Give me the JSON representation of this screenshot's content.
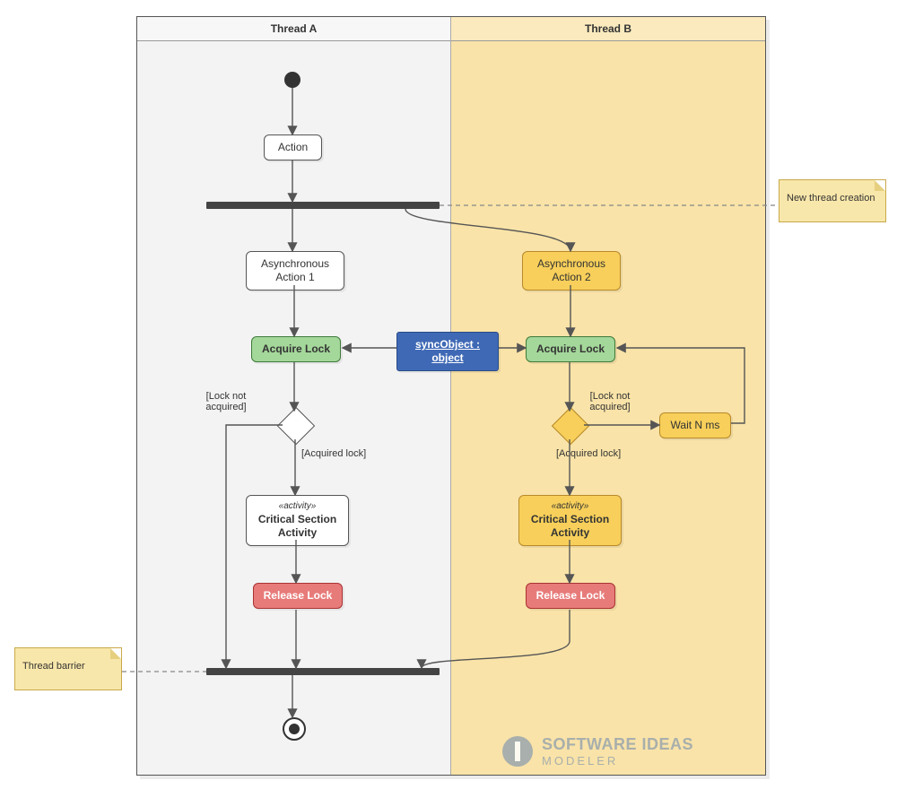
{
  "lanes": {
    "a": "Thread A",
    "b": "Thread B"
  },
  "nodes": {
    "action": "Action",
    "async1": "Asynchronous Action 1",
    "async2": "Asynchronous Action 2",
    "acquireA": "Acquire Lock",
    "acquireB": "Acquire Lock",
    "syncObj": "syncObject : object",
    "waitN": "Wait N ms",
    "critA_stereo": "«activity»",
    "critA_main": "Critical Section Activity",
    "critB_stereo": "«activity»",
    "critB_main": "Critical Section Activity",
    "releaseA": "Release Lock",
    "releaseB": "Release Lock"
  },
  "guards": {
    "notAcqA": "[Lock not acquired]",
    "acqA": "[Acquired lock]",
    "notAcqB": "[Lock not acquired]",
    "acqB": "[Acquired lock]"
  },
  "notes": {
    "newThread": "New thread creation",
    "barrier": "Thread barrier"
  },
  "watermark": {
    "line1": "SOFTWARE IDEAS",
    "line2": "MODELER"
  }
}
